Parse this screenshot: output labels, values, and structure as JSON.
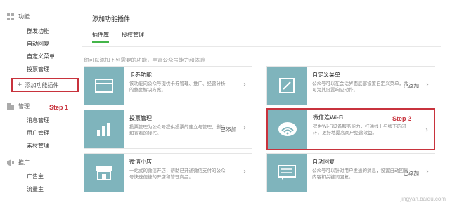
{
  "sidebar": {
    "function_header": "功能",
    "function_items": [
      "群发功能",
      "自动回复",
      "自定义菜单",
      "投票管理"
    ],
    "add_plugin": "添加功能插件",
    "step1": "Step 1",
    "manage_header": "管理",
    "manage_items": [
      "消息管理",
      "用户管理",
      "素材管理"
    ],
    "promo_header": "推广",
    "promo_items": [
      "广告主",
      "流量主"
    ]
  },
  "main": {
    "title": "添加功能插件",
    "tabs": [
      "插件库",
      "授权管理"
    ],
    "intro": "你可以添加下列需要的功能，丰富公众号能力和体验",
    "cards": [
      {
        "name": "卡券功能",
        "desc": "该功能向公众号提供卡券管理、推广、经营分析的整套解决方案。",
        "added": "",
        "icon": "card-icon"
      },
      {
        "name": "自定义菜单",
        "desc": "公众号可以在会话界面底部设置自定义菜单，并可为其设置响应动作。",
        "added": "已添加",
        "icon": "pencil-icon"
      },
      {
        "name": "投票管理",
        "desc": "投票管理为公众号提供投票的建立与管理，删除和查看的操作。",
        "added": "已添加",
        "icon": "bar-chart-icon"
      },
      {
        "name": "微信连Wi-Fi",
        "desc": "提供Wi-Fi设备服务能力，打通线上与线下的闭环，更好地提高商户经营效益。",
        "added": "",
        "icon": "wifi-icon"
      },
      {
        "name": "微信小店",
        "desc": "一站式的微信开店，帮助已开通微信支付的公众号快速便捷的开店和管理商品。",
        "added": "",
        "icon": "shop-icon"
      },
      {
        "name": "自动回复",
        "desc": "公众号可以针对用户发送的消息，设置自动回复内容和关键词回复。",
        "added": "已添加",
        "icon": "reply-icon"
      }
    ],
    "step2": "Step 2"
  },
  "watermark": "jingyan.baidu.com",
  "colors": {
    "accent_green": "#44b549",
    "highlight_red": "#c8333d",
    "thumb_teal": "#7fb4bc"
  }
}
